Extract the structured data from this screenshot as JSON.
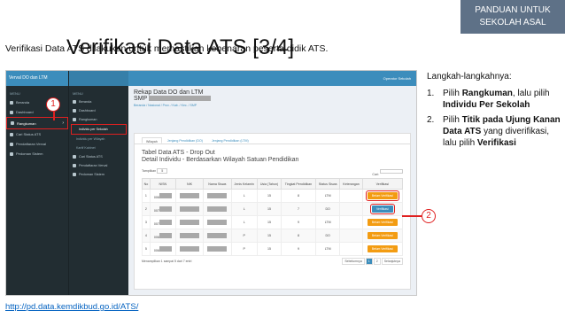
{
  "badge": "PANDUAN UNTUK SEKOLAH ASAL",
  "title": "Verifikasi Data ATS [3/4]",
  "subtitle": "Verifikasi Data ATS dilakukan untuk memastikan kebenaran peserta didik ATS.",
  "app": {
    "brand": "Verval DO dan LTM",
    "menu_label": "MENU",
    "sidebar1": [
      "Beranda",
      "Dashboard",
      "Rangkuman",
      "Cari Status ATS",
      "Pendaftaran Verval",
      "Pedoman Sistem"
    ],
    "sidebar2": [
      "Beranda",
      "Dashboard",
      "Rangkuman",
      "Cari Status ATS",
      "Pendaftaran Verval",
      "Pedoman Sistem"
    ],
    "sidebar2_sub": [
      "Individu per Sekolah",
      "Individu per Wilayah",
      "Kartif Kabinet"
    ],
    "operator": "Operator Sekolah",
    "page_title": "Rekap Data DO dan LTM",
    "page_school": "SMP",
    "filters": "Beranda / Nasional / Prov.  /  Kab.  /  Kec.  /  SMP",
    "tabs": [
      "Wilayah",
      "Jenjang Pendidikan (DO)",
      "Jenjang Pendidikan (LTM)"
    ],
    "table_title_1": "Tabel Data ATS - Drop Out",
    "table_title_2": "Detail Individu - Berdasarkan Wilayah Satuan Pendidikan",
    "show_label": "Tampilkan",
    "show_value": "5",
    "search_label": "Cari:",
    "columns": [
      "No",
      "NISN",
      "NIK",
      "Nama Siswa",
      "Jenis Kelamin",
      "Usia (Tahun)",
      "Tingkat Pendidikan",
      "Status Siswa",
      "Keterangan",
      "Verifikasi"
    ],
    "rows": [
      {
        "no": "1",
        "nisn": "006",
        "jk": "L",
        "usia": "15",
        "tingkat": "8",
        "status": "LTM",
        "btn": "Belum Verifikasi",
        "hl": true
      },
      {
        "no": "2",
        "nisn": "007",
        "jk": "L",
        "usia": "15",
        "tingkat": "7",
        "status": "DO",
        "btn": "Verifikasi",
        "hl": true,
        "blue": true
      },
      {
        "no": "3",
        "nisn": "007",
        "jk": "L",
        "usia": "15",
        "tingkat": "9",
        "status": "LTM",
        "btn": "Belum Verifikasi"
      },
      {
        "no": "4",
        "nisn": "006",
        "jk": "P",
        "usia": "15",
        "tingkat": "8",
        "status": "DO",
        "btn": "Belum Verifikasi"
      },
      {
        "no": "5",
        "nisn": "006",
        "jk": "P",
        "usia": "15",
        "tingkat": "9",
        "status": "LTM",
        "btn": "Belum Verifikasi"
      }
    ],
    "footer_text": "Menampilkan 1 sampai 5 dari 7 entri",
    "pager": [
      "Sebelumnya",
      "1",
      "2",
      "Selanjutnya"
    ]
  },
  "callouts": [
    "1",
    "2"
  ],
  "steps_title": "Langkah-langkahnya:",
  "steps": [
    {
      "n": "1.",
      "pre": "Pilih ",
      "b1": "Rangkuman",
      "mid": ", lalu pilih ",
      "b2": "Individu Per Sekolah",
      "post": ""
    },
    {
      "n": "2.",
      "pre": "Pilih ",
      "b1": "Titik pada Ujung Kanan Data ATS",
      "mid": " yang diverifikasi, lalu pilih ",
      "b2": "Verifikasi",
      "post": ""
    }
  ],
  "link": "http://pd.data.kemdikbud.go.id/ATS/"
}
